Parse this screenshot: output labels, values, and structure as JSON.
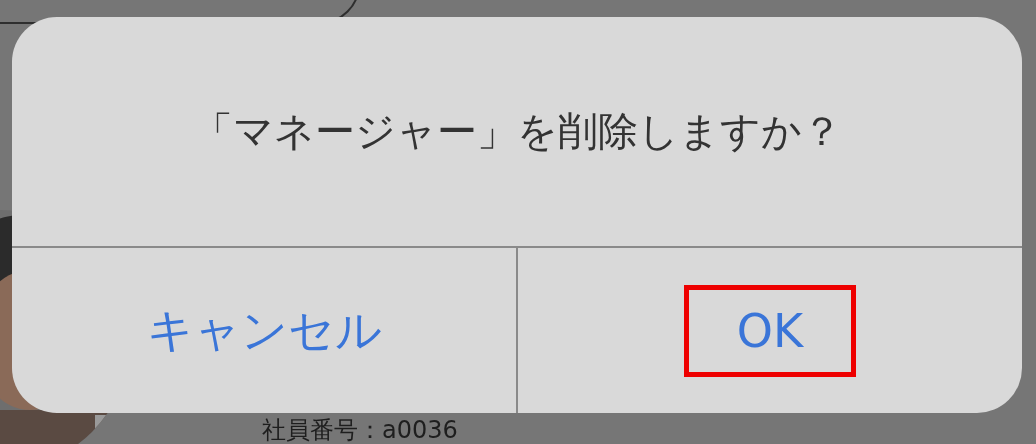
{
  "background": {
    "employee_number": "社員番号：a0036"
  },
  "alert": {
    "message": "「マネージャー」を削除しますか？",
    "buttons": [
      {
        "label": "キャンセル",
        "highlighted": false
      },
      {
        "label": "OK",
        "highlighted": true
      }
    ]
  }
}
